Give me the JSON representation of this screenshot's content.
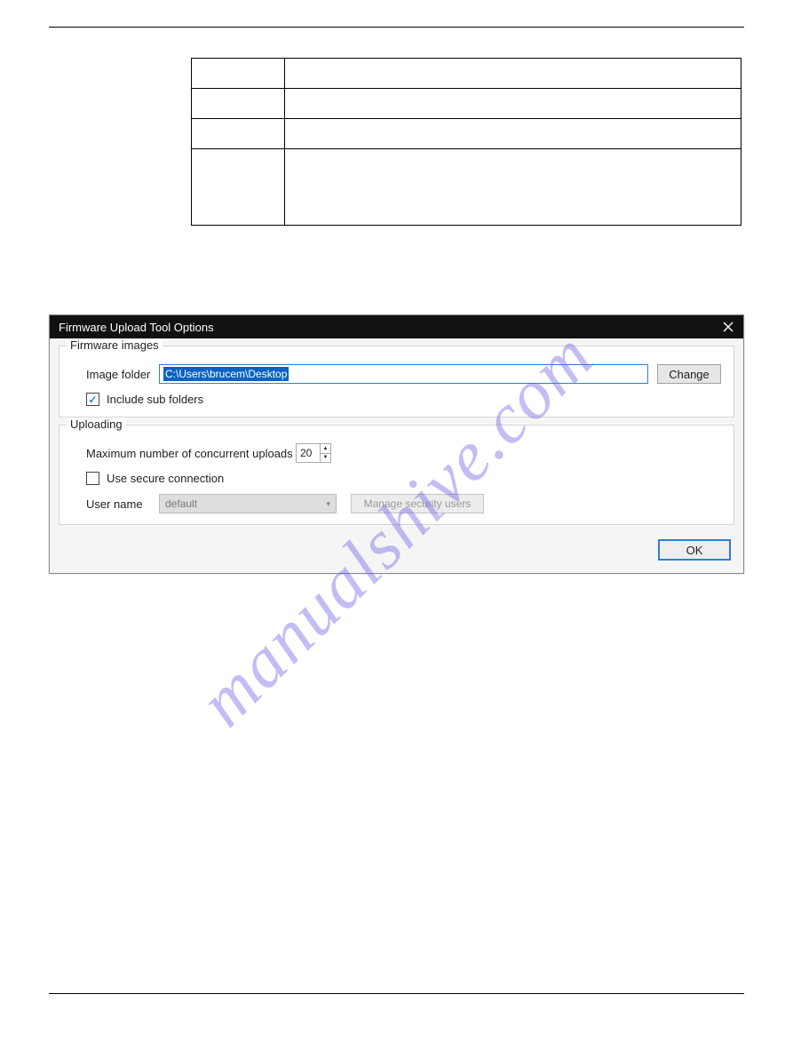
{
  "watermark": "manualshive.com",
  "dialog": {
    "title": "Firmware Upload Tool Options",
    "firmware_images": {
      "legend": "Firmware images",
      "image_folder_label": "Image folder",
      "image_folder_value": "C:\\Users\\brucem\\Desktop",
      "change_button": "Change",
      "include_sub_folders_label": "Include sub folders",
      "include_sub_folders_checked": true
    },
    "uploading": {
      "legend": "Uploading",
      "max_concurrent_label": "Maximum number of concurrent uploads",
      "max_concurrent_value": "20",
      "use_secure_label": "Use secure connection",
      "use_secure_checked": false,
      "user_name_label": "User name",
      "user_name_value": "default",
      "manage_users_button": "Manage security users"
    },
    "ok_button": "OK"
  }
}
